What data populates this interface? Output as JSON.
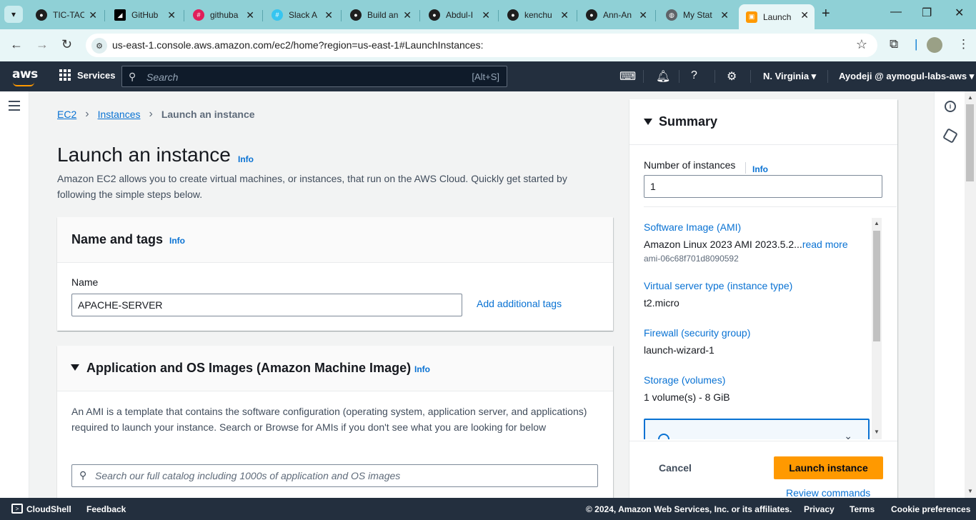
{
  "browser": {
    "tabs": [
      {
        "label": "TIC-TAC",
        "icon": "github-icon",
        "color": "#1f1f1f"
      },
      {
        "label": "GitHub",
        "icon": "github-dark-icon",
        "color": "#000000"
      },
      {
        "label": "githuba",
        "icon": "slack-icon",
        "color": "#e01e5a"
      },
      {
        "label": "Slack A",
        "icon": "slack-icon",
        "color": "#e01e5a"
      },
      {
        "label": "Build an",
        "icon": "github-icon",
        "color": "#1f1f1f"
      },
      {
        "label": "Abdul-I",
        "icon": "github-icon",
        "color": "#1f1f1f"
      },
      {
        "label": "kenchu",
        "icon": "github-icon",
        "color": "#1f1f1f"
      },
      {
        "label": "Ann-An",
        "icon": "github-icon",
        "color": "#1f1f1f"
      },
      {
        "label": "My Stat",
        "icon": "globe-icon",
        "color": "#5f6368"
      },
      {
        "label": "Launch",
        "icon": "aws-ec2-icon",
        "color": "#ff9900"
      }
    ],
    "url": "us-east-1.console.aws.amazon.com/ec2/home?region=us-east-1#LaunchInstances:"
  },
  "aws_nav": {
    "logo": "aws",
    "services_label": "Services",
    "search_placeholder": "Search",
    "search_shortcut": "[Alt+S]",
    "region": "N. Virginia",
    "account": "Ayodeji @ aymogul-labs-aws"
  },
  "breadcrumb": {
    "root": "EC2",
    "parent": "Instances",
    "current": "Launch an instance"
  },
  "page": {
    "title": "Launch an instance",
    "info": "Info",
    "intro": "Amazon EC2 allows you to create virtual machines, or instances, that run on the AWS Cloud. Quickly get started by following the simple steps below."
  },
  "name_tags": {
    "title": "Name and tags",
    "info": "Info",
    "name_label": "Name",
    "name_value": "APACHE-SERVER",
    "add_tags": "Add additional tags"
  },
  "ami_section": {
    "title": "Application and OS Images (Amazon Machine Image)",
    "info": "Info",
    "description": "An AMI is a template that contains the software configuration (operating system, application server, and applications) required to launch your instance. Search or Browse for AMIs if you don't see what you are looking for below",
    "search_placeholder": "Search our full catalog including 1000s of application and OS images"
  },
  "summary": {
    "title": "Summary",
    "instances_label": "Number of instances",
    "instances_info": "Info",
    "instances_value": "1",
    "ami_label": "Software Image (AMI)",
    "ami_value": "Amazon Linux 2023 AMI 2023.5.2...",
    "ami_read_more": "read more",
    "ami_id": "ami-06c68f701d8090592",
    "type_label": "Virtual server type (instance type)",
    "type_value": "t2.micro",
    "firewall_label": "Firewall (security group)",
    "firewall_value": "launch-wizard-1",
    "storage_label": "Storage (volumes)",
    "storage_value": "1 volume(s) - 8 GiB",
    "cancel": "Cancel",
    "launch": "Launch instance",
    "review": "Review commands"
  },
  "footer": {
    "cloudshell": "CloudShell",
    "feedback": "Feedback",
    "copyright": "© 2024, Amazon Web Services, Inc. or its affiliates.",
    "privacy": "Privacy",
    "terms": "Terms",
    "cookies": "Cookie preferences"
  },
  "colors": {
    "aws_nav": "#232f3e",
    "link": "#0972d3",
    "primary_button": "#ff9900",
    "browser_chrome": "#8fd0d6"
  }
}
